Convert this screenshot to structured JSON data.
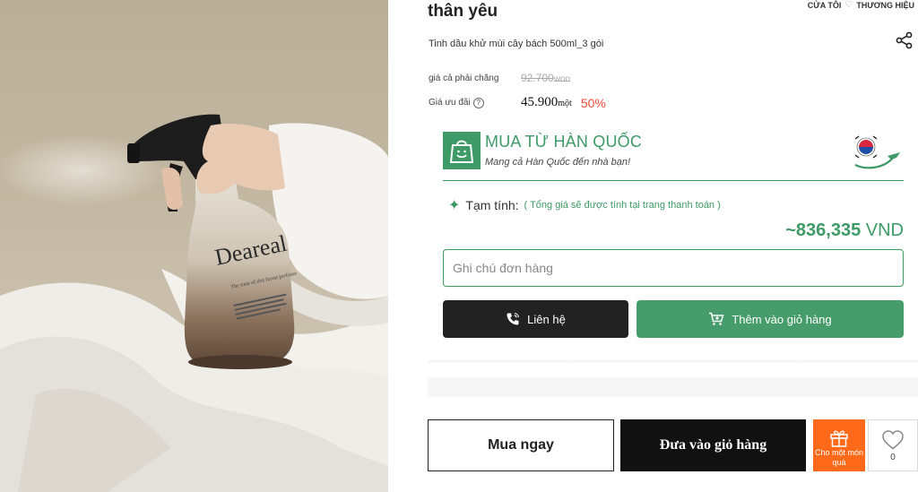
{
  "header": {
    "store_link": "CỬA TÔI",
    "brand_link": "THƯƠNG HIỆU"
  },
  "product": {
    "title": "thân yêu",
    "name": "Tinh dầu khử mùi cây bách 500ml_3 gói",
    "bottle_brand": "Deareal",
    "bottle_tagline": "The time of this forest perfume"
  },
  "pricing": {
    "original_label": "giá cả phải chăng",
    "original_amount": "92.700",
    "original_unit": "won",
    "sale_label": "Giá ưu đãi",
    "sale_amount": "45.900",
    "sale_unit": "một",
    "discount": "50%"
  },
  "korea_banner": {
    "title": "MUA TỪ HÀN QUỐC",
    "subtitle": "Mang cả Hàn Quốc đến nhà bạn!"
  },
  "subtotal": {
    "label": "Tạm tính:",
    "note": "( Tổng giá sẽ được tính tại trang thanh toán )",
    "amount": "~836,335",
    "currency": "VND"
  },
  "order_note": {
    "placeholder": "Ghi chú đơn hàng",
    "value": ""
  },
  "actions": {
    "contact_label": "Liên hệ",
    "add_to_cart_label": "Thêm vào giỏ hàng",
    "buy_now_label": "Mua ngay",
    "add_to_bag_label": "Đưa vào giỏ hàng",
    "gift_label": "Cho một món quà",
    "wishlist_count": "0"
  },
  "colors": {
    "accent_green": "#3e9a66",
    "discount_red": "#ef4a3a",
    "gift_orange": "#ff6a1a",
    "dark_button": "#222222"
  },
  "icons": {
    "share": "share-icon",
    "help": "question-circle-icon",
    "bag": "shopping-bag-smile-icon",
    "phone": "phone-icon",
    "cart": "cart-icon",
    "gift": "gift-icon",
    "heart": "heart-icon"
  }
}
